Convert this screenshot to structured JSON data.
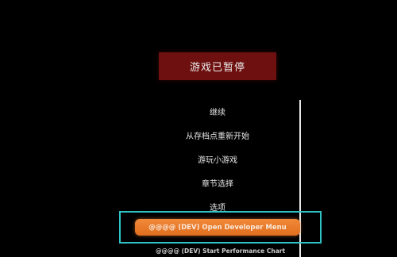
{
  "pause_menu": {
    "title": "游戏已暂停",
    "items": [
      "继续",
      "从存档点重新开始",
      "游玩小游戏",
      "章节选择",
      "选项"
    ],
    "dev_menu_button": "@@@@ (DEV) Open Developer Menu",
    "dev_perf_chart": "@@@@ (DEV) Start Performance Chart"
  },
  "colors": {
    "background": "#000000",
    "title_banner": "#6e1010",
    "dev_button": "#e87a2a",
    "highlight_outline": "#2fc3c3",
    "text": "#e8e8e8"
  }
}
